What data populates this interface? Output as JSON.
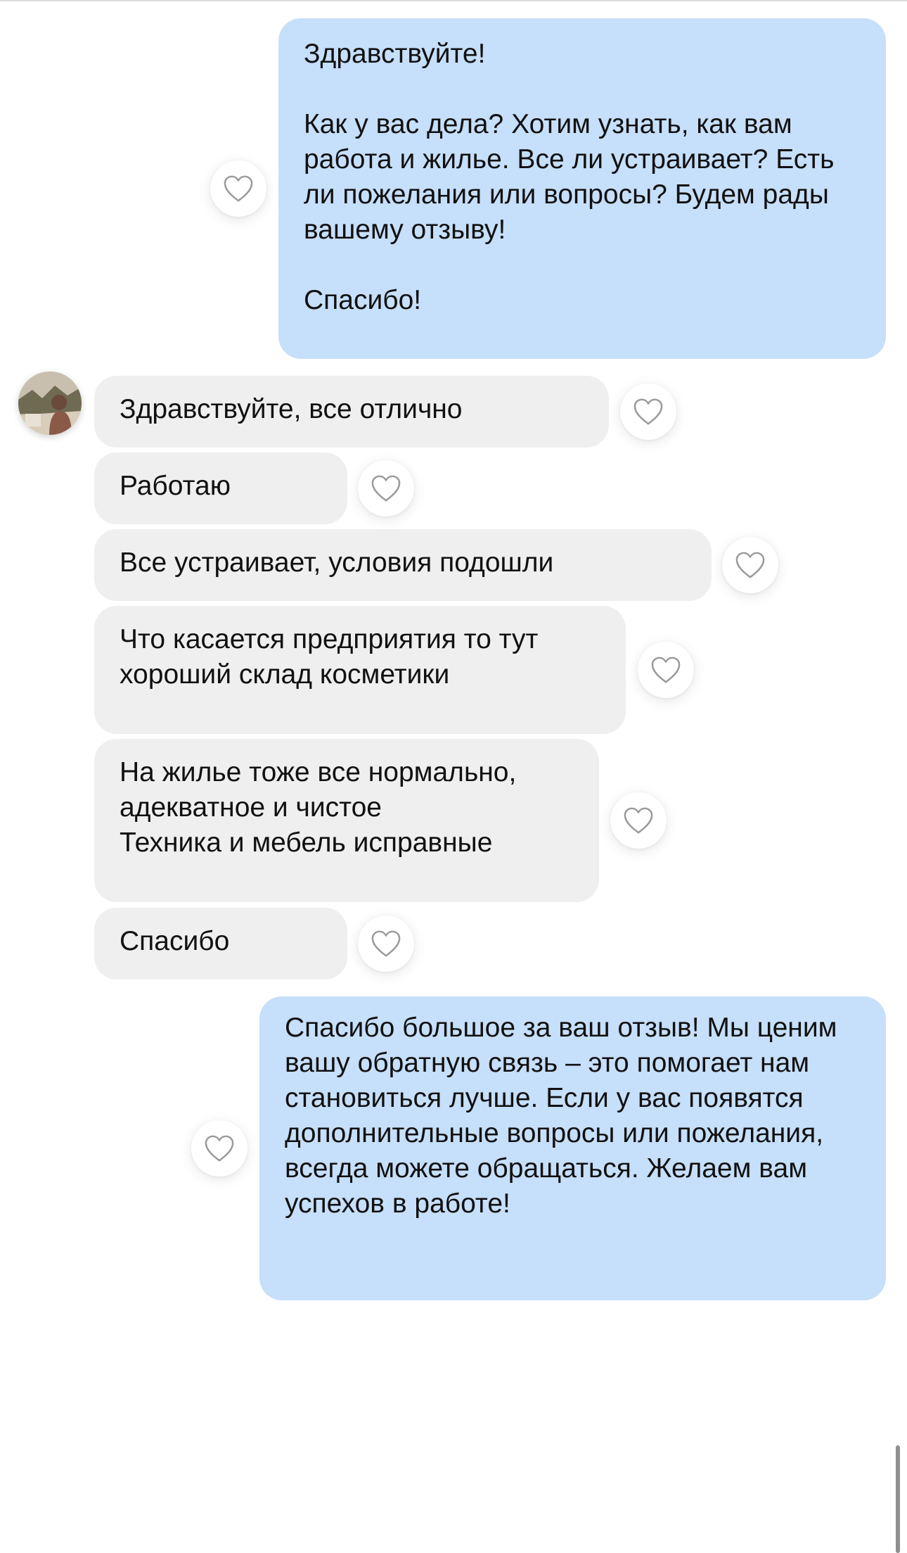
{
  "messages": [
    {
      "id": "m1",
      "direction": "out",
      "text": "Здравствуйте!\n\nКак у вас дела? Хотим узнать, как вам работа и жилье. Все ли устраивает? Есть ли пожелания или вопросы? Будем рады вашему отзыву!\n\nСпасибо!"
    },
    {
      "id": "m2",
      "direction": "in",
      "text": "Здравствуйте, все отлично"
    },
    {
      "id": "m3",
      "direction": "in",
      "text": "Работаю"
    },
    {
      "id": "m4",
      "direction": "in",
      "text": "Все устраивает, условия подошли"
    },
    {
      "id": "m5",
      "direction": "in",
      "text": "Что касается предприятия то тут хороший склад косметики"
    },
    {
      "id": "m6",
      "direction": "in",
      "text": "На жилье тоже все нормально, адекватное и чистое\nТехника и мебель исправные"
    },
    {
      "id": "m7",
      "direction": "in",
      "text": "Спасибо"
    },
    {
      "id": "m8",
      "direction": "out",
      "text": "Спасибо большое за ваш отзыв! Мы ценим вашу обратную связь – это помогает нам становиться лучше. Если у вас появятся дополнительные вопросы или пожелания, всегда можете обращаться. Желаем вам успехов в работе!"
    }
  ],
  "icons": {
    "like": "heart-outline-icon",
    "avatar": "user-avatar-photo"
  },
  "colors": {
    "outgoing_bubble": "#c6dffa",
    "incoming_bubble": "#efefef",
    "heart_outline": "#9a9a9a",
    "background": "#ffffff"
  }
}
